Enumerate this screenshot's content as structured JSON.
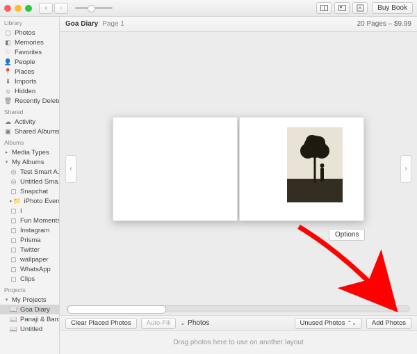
{
  "titlebar": {
    "buy_label": "Buy Book"
  },
  "header": {
    "title": "Goa Diary",
    "page": "Page 1",
    "price": "20 Pages – $9.99"
  },
  "sidebar": {
    "sections": {
      "library_h": "Library",
      "shared_h": "Shared",
      "albums_h": "Albums",
      "projects_h": "Projects"
    },
    "library": [
      {
        "label": "Photos"
      },
      {
        "label": "Memories"
      },
      {
        "label": "Favorites"
      },
      {
        "label": "People"
      },
      {
        "label": "Places"
      },
      {
        "label": "Imports"
      },
      {
        "label": "Hidden"
      },
      {
        "label": "Recently Deleted"
      }
    ],
    "shared": [
      {
        "label": "Activity"
      },
      {
        "label": "Shared Albums"
      }
    ],
    "albums": [
      {
        "label": "Media Types"
      },
      {
        "label": "My Albums"
      },
      {
        "label": "Test Smart A..."
      },
      {
        "label": "Untitled Sma..."
      },
      {
        "label": "Snapchat"
      },
      {
        "label": "iPhoto Events"
      },
      {
        "label": "I"
      },
      {
        "label": "Fun Moments"
      },
      {
        "label": "Instagram"
      },
      {
        "label": "Prisma"
      },
      {
        "label": "Twitter"
      },
      {
        "label": "wallpaper"
      },
      {
        "label": "WhatsApp"
      },
      {
        "label": "Clips"
      }
    ],
    "projects": [
      {
        "label": "My Projects"
      },
      {
        "label": "Goa Diary"
      },
      {
        "label": "Panaji & Bard..."
      },
      {
        "label": "Untitled"
      }
    ]
  },
  "canvas": {
    "options_label": "Options"
  },
  "toolbar": {
    "clear_label": "Clear Placed Photos",
    "autofill_label": "Auto-Fill",
    "photos_dd_label": "Photos",
    "unused_label": "Unused Photos",
    "add_label": "Add Photos"
  },
  "footer_hint": "Drag photos here to use on another layout"
}
